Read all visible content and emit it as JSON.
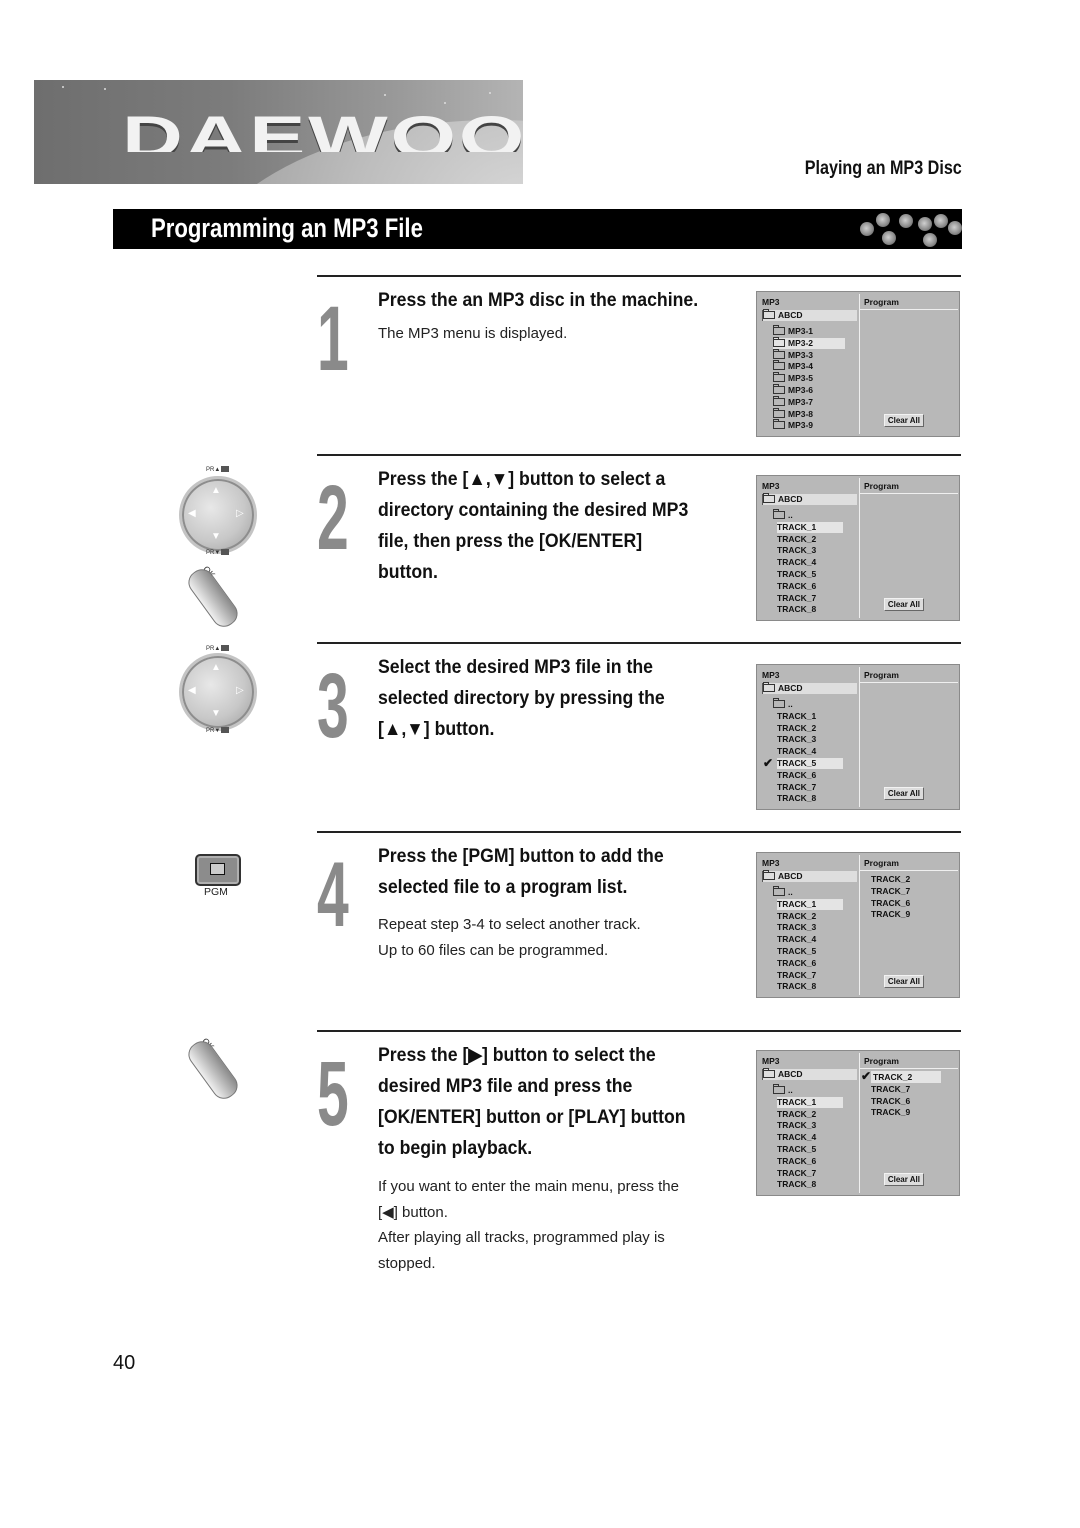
{
  "header": {
    "brand_logo": "DAEWOO",
    "section": "Playing an MP3 Disc",
    "title": "Programming an MP3 File"
  },
  "steps": [
    {
      "number": "1",
      "heading_lines": [
        "Press the an MP3 disc in the machine."
      ],
      "body_lines": [
        "The MP3 menu is displayed."
      ],
      "osd": {
        "left_header": "MP3",
        "right_header": "Program",
        "root": "ABCD",
        "items": [
          {
            "label": "MP3-1",
            "folder": true,
            "selected": false,
            "checked": false
          },
          {
            "label": "MP3-2",
            "folder": true,
            "selected": true,
            "checked": false
          },
          {
            "label": "MP3-3",
            "folder": true,
            "selected": false,
            "checked": false
          },
          {
            "label": "MP3-4",
            "folder": true,
            "selected": false,
            "checked": false
          },
          {
            "label": "MP3-5",
            "folder": true,
            "selected": false,
            "checked": false
          },
          {
            "label": "MP3-6",
            "folder": true,
            "selected": false,
            "checked": false
          },
          {
            "label": "MP3-7",
            "folder": true,
            "selected": false,
            "checked": false
          },
          {
            "label": "MP3-8",
            "folder": true,
            "selected": false,
            "checked": false
          },
          {
            "label": "MP3-9",
            "folder": true,
            "selected": false,
            "checked": false
          }
        ],
        "program": [],
        "clear_all": "Clear All"
      }
    },
    {
      "number": "2",
      "heading_lines": [
        "Press the [▲,▼] button to select a",
        "directory containing the desired MP3",
        "file, then press the [OK/ENTER]",
        "button."
      ],
      "body_lines": [],
      "osd": {
        "left_header": "MP3",
        "right_header": "Program",
        "root": "ABCD",
        "items": [
          {
            "label": "..",
            "folder": true,
            "selected": false,
            "checked": false
          },
          {
            "label": "TRACK_1",
            "folder": false,
            "selected": true,
            "checked": false
          },
          {
            "label": "TRACK_2",
            "folder": false,
            "selected": false,
            "checked": false
          },
          {
            "label": "TRACK_3",
            "folder": false,
            "selected": false,
            "checked": false
          },
          {
            "label": "TRACK_4",
            "folder": false,
            "selected": false,
            "checked": false
          },
          {
            "label": "TRACK_5",
            "folder": false,
            "selected": false,
            "checked": false
          },
          {
            "label": "TRACK_6",
            "folder": false,
            "selected": false,
            "checked": false
          },
          {
            "label": "TRACK_7",
            "folder": false,
            "selected": false,
            "checked": false
          },
          {
            "label": "TRACK_8",
            "folder": false,
            "selected": false,
            "checked": false
          }
        ],
        "program": [],
        "clear_all": "Clear All"
      }
    },
    {
      "number": "3",
      "heading_lines": [
        "Select the desired MP3 file in the",
        "selected directory by pressing the",
        "[▲,▼] button."
      ],
      "body_lines": [],
      "osd": {
        "left_header": "MP3",
        "right_header": "Program",
        "root": "ABCD",
        "items": [
          {
            "label": "..",
            "folder": true,
            "selected": false,
            "checked": false
          },
          {
            "label": "TRACK_1",
            "folder": false,
            "selected": false,
            "checked": false
          },
          {
            "label": "TRACK_2",
            "folder": false,
            "selected": false,
            "checked": false
          },
          {
            "label": "TRACK_3",
            "folder": false,
            "selected": false,
            "checked": false
          },
          {
            "label": "TRACK_4",
            "folder": false,
            "selected": false,
            "checked": false
          },
          {
            "label": "TRACK_5",
            "folder": false,
            "selected": true,
            "checked": true
          },
          {
            "label": "TRACK_6",
            "folder": false,
            "selected": false,
            "checked": false
          },
          {
            "label": "TRACK_7",
            "folder": false,
            "selected": false,
            "checked": false
          },
          {
            "label": "TRACK_8",
            "folder": false,
            "selected": false,
            "checked": false
          }
        ],
        "program": [],
        "clear_all": "Clear All"
      }
    },
    {
      "number": "4",
      "heading_lines": [
        "Press the [PGM] button to add the",
        "selected file to a program list."
      ],
      "body_lines": [
        "Repeat step 3-4 to select another track.",
        "Up to 60 files can be programmed."
      ],
      "osd": {
        "left_header": "MP3",
        "right_header": "Program",
        "root": "ABCD",
        "items": [
          {
            "label": "..",
            "folder": true,
            "selected": false,
            "checked": false
          },
          {
            "label": "TRACK_1",
            "folder": false,
            "selected": true,
            "checked": false
          },
          {
            "label": "TRACK_2",
            "folder": false,
            "selected": false,
            "checked": false
          },
          {
            "label": "TRACK_3",
            "folder": false,
            "selected": false,
            "checked": false
          },
          {
            "label": "TRACK_4",
            "folder": false,
            "selected": false,
            "checked": false
          },
          {
            "label": "TRACK_5",
            "folder": false,
            "selected": false,
            "checked": false
          },
          {
            "label": "TRACK_6",
            "folder": false,
            "selected": false,
            "checked": false
          },
          {
            "label": "TRACK_7",
            "folder": false,
            "selected": false,
            "checked": false
          },
          {
            "label": "TRACK_8",
            "folder": false,
            "selected": false,
            "checked": false
          }
        ],
        "program": [
          {
            "label": "TRACK_2",
            "selected": false,
            "checked": false
          },
          {
            "label": "TRACK_7",
            "selected": false,
            "checked": false
          },
          {
            "label": "TRACK_6",
            "selected": false,
            "checked": false
          },
          {
            "label": "TRACK_9",
            "selected": false,
            "checked": false
          }
        ],
        "clear_all": "Clear All"
      }
    },
    {
      "number": "5",
      "heading_lines": [
        "Press the [▶] button to select the",
        "desired MP3 file and press the",
        "[OK/ENTER] button or [PLAY] button",
        "to begin playback."
      ],
      "body_lines": [
        "If you want to enter the main menu, press the",
        "[◀] button.",
        "After playing all tracks, programmed play is",
        "stopped."
      ],
      "osd": {
        "left_header": "MP3",
        "right_header": "Program",
        "root": "ABCD",
        "items": [
          {
            "label": "..",
            "folder": true,
            "selected": false,
            "checked": false
          },
          {
            "label": "TRACK_1",
            "folder": false,
            "selected": true,
            "checked": false
          },
          {
            "label": "TRACK_2",
            "folder": false,
            "selected": false,
            "checked": false
          },
          {
            "label": "TRACK_3",
            "folder": false,
            "selected": false,
            "checked": false
          },
          {
            "label": "TRACK_4",
            "folder": false,
            "selected": false,
            "checked": false
          },
          {
            "label": "TRACK_5",
            "folder": false,
            "selected": false,
            "checked": false
          },
          {
            "label": "TRACK_6",
            "folder": false,
            "selected": false,
            "checked": false
          },
          {
            "label": "TRACK_7",
            "folder": false,
            "selected": false,
            "checked": false
          },
          {
            "label": "TRACK_8",
            "folder": false,
            "selected": false,
            "checked": false
          }
        ],
        "program": [
          {
            "label": "TRACK_2",
            "selected": true,
            "checked": true
          },
          {
            "label": "TRACK_7",
            "selected": false,
            "checked": false
          },
          {
            "label": "TRACK_6",
            "selected": false,
            "checked": false
          },
          {
            "label": "TRACK_9",
            "selected": false,
            "checked": false
          }
        ],
        "clear_all": "Clear All"
      }
    }
  ],
  "remote": {
    "pr_up": "PR▲",
    "pr_down": "PR▼",
    "ok_enter": [
      "OK",
      "ENTER"
    ],
    "pgm": "PGM",
    "arrows": {
      "up": "▲",
      "down": "▼",
      "left": "◀",
      "right": "▷"
    },
    "check_glyph": "✔"
  },
  "footer": {
    "page_number": "40"
  }
}
